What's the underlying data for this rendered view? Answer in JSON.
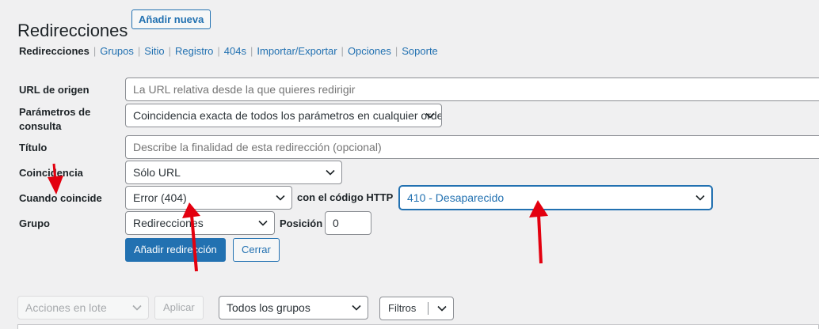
{
  "header": {
    "title": "Redirecciones",
    "add_new_label": "Añadir nueva"
  },
  "subnav": {
    "items": [
      {
        "label": "Redirecciones",
        "current": true
      },
      {
        "label": "Grupos"
      },
      {
        "label": "Sitio"
      },
      {
        "label": "Registro"
      },
      {
        "label": "404s"
      },
      {
        "label": "Importar/Exportar"
      },
      {
        "label": "Opciones"
      },
      {
        "label": "Soporte"
      }
    ],
    "separator": "|"
  },
  "form": {
    "source_url": {
      "label": "URL de origen",
      "placeholder": "La URL relativa desde la que quieres redirigir"
    },
    "query_params": {
      "label": "Parámetros de consulta",
      "value": "Coincidencia exacta de todos los parámetros en cualquier orden"
    },
    "title": {
      "label": "Título",
      "placeholder": "Describe la finalidad de esta redirección (opcional)"
    },
    "match": {
      "label": "Coincidencia",
      "value": "Sólo URL"
    },
    "when_matched": {
      "label": "Cuando coincide",
      "value": "Error (404)",
      "http_code_label": "con el código HTTP",
      "http_code_value": "410 - Desaparecido"
    },
    "group": {
      "label": "Grupo",
      "value": "Redirecciones",
      "position_label": "Posición",
      "position_value": "0"
    },
    "add_button": "Añadir redirección",
    "cancel_button": "Cerrar"
  },
  "table_nav": {
    "bulk_actions": "Acciones en lote",
    "apply": "Aplicar",
    "groups_filter": "Todos los grupos",
    "filters": "Filtros"
  },
  "colors": {
    "accent": "#2271b1",
    "annotation_arrow": "#e3000f",
    "background": "#f0f0f1"
  },
  "icons": {
    "select_chevron": "chevron-down-icon",
    "annotation": "arrow-annotation"
  }
}
